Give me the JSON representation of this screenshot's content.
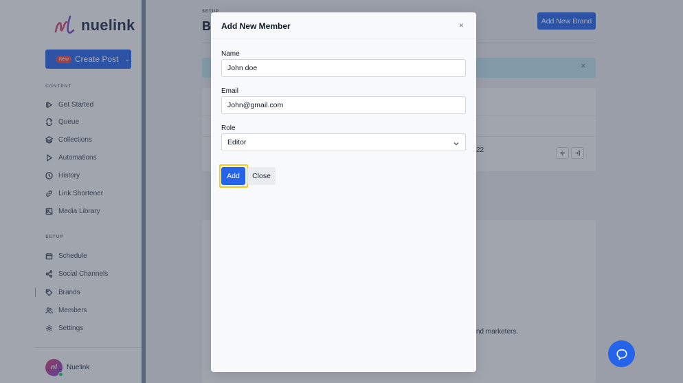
{
  "brand": {
    "logo_text": "nuelink"
  },
  "sidebar": {
    "create_post": {
      "badge": "New",
      "label": "Create Post"
    },
    "content_label": "CONTENT",
    "content_items": [
      {
        "label": "Get Started",
        "icon": "get-started-icon"
      },
      {
        "label": "Queue",
        "icon": "queue-icon"
      },
      {
        "label": "Collections",
        "icon": "layers-icon"
      },
      {
        "label": "Automations",
        "icon": "play-icon"
      },
      {
        "label": "History",
        "icon": "clock-icon"
      },
      {
        "label": "Link Shortener",
        "icon": "link-icon"
      },
      {
        "label": "Media Library",
        "icon": "image-icon"
      }
    ],
    "setup_label": "SETUP",
    "setup_items": [
      {
        "label": "Schedule",
        "icon": "calendar-icon"
      },
      {
        "label": "Social Channels",
        "icon": "share-icon"
      },
      {
        "label": "Brands",
        "icon": "tag-icon"
      },
      {
        "label": "Members",
        "icon": "users-icon"
      },
      {
        "label": "Settings",
        "icon": "gear-icon"
      }
    ],
    "user": {
      "name": "Nuelink",
      "initials": "nl"
    }
  },
  "page": {
    "section": "SETUP",
    "title_fragment": "B",
    "add_brand": "Add New Brand",
    "date_fragment": "22",
    "marketers_fragment": "nd marketers."
  },
  "modal": {
    "title": "Add New Member",
    "name_label": "Name",
    "name_value": "John doe",
    "email_label": "Email",
    "email_value": "John@gmail.com",
    "role_label": "Role",
    "role_value": "Editor",
    "add_button": "Add",
    "close_button": "Close"
  },
  "colors": {
    "accent": "#2563eb",
    "highlight": "#facc15",
    "alert": "#bfe3ee"
  }
}
